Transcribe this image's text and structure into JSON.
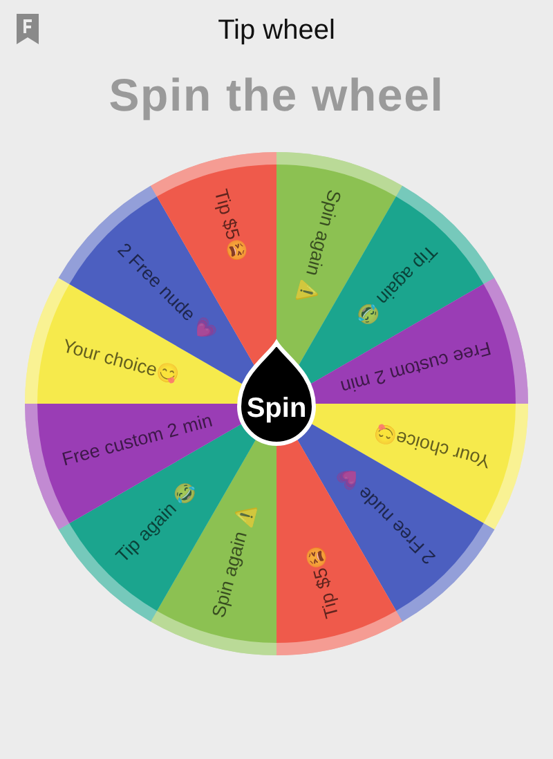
{
  "header": {
    "title": "Tip wheel"
  },
  "heading": "Spin the wheel",
  "wheel": {
    "button": "Spin",
    "segments": [
      {
        "label": "Spin again ⚠️",
        "color": "#8cc152"
      },
      {
        "label": "Tip again 😂",
        "color": "#1ba58e"
      },
      {
        "label": "Free custom 2 min",
        "color": "#9a3db5"
      },
      {
        "label": "Your choice😋",
        "color": "#f6ea4c"
      },
      {
        "label": "2 Free nude 💗",
        "color": "#4c5fc0"
      },
      {
        "label": "Tip $5😫",
        "color": "#ef5a4b"
      },
      {
        "label": "Spin again ⚠️",
        "color": "#8cc152"
      },
      {
        "label": "Tip again 😂",
        "color": "#1ba58e"
      },
      {
        "label": "Free custom 2 min",
        "color": "#9a3db5"
      },
      {
        "label": "Your choice😋",
        "color": "#f6ea4c"
      },
      {
        "label": "2 Free nude 💗",
        "color": "#4c5fc0"
      },
      {
        "label": "Tip $5😫",
        "color": "#ef5a4b"
      }
    ]
  }
}
